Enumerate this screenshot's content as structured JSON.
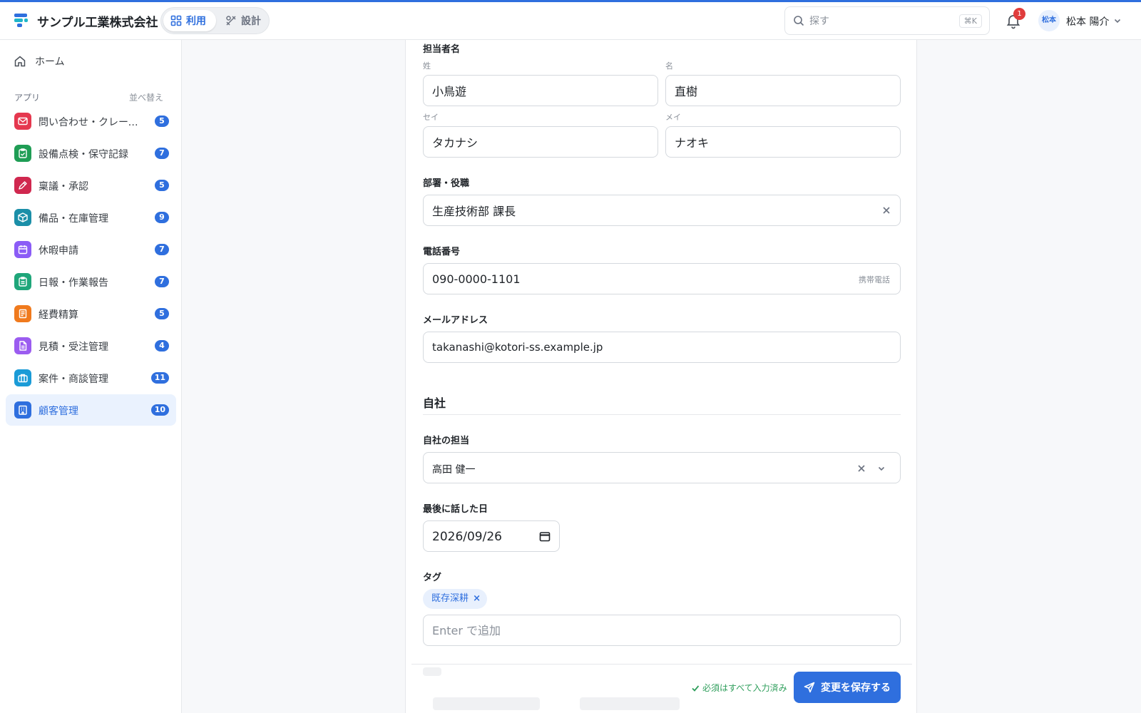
{
  "header": {
    "company": "サンプル工業株式会社",
    "mode_use": "利用",
    "mode_design": "設計",
    "search_placeholder": "探す",
    "search_shortcut": "⌘K",
    "notification_count": "1",
    "avatar_text": "松本",
    "user_name": "松本 陽介"
  },
  "sidebar": {
    "home": "ホーム",
    "apps_label": "アプリ",
    "sort_label": "並べ替え",
    "apps": [
      {
        "label": "問い合わせ・クレーム管理",
        "count": "5",
        "color": "#e5384f",
        "icon": "mail-icon"
      },
      {
        "label": "設備点検・保守記録",
        "count": "7",
        "color": "#1f9d55",
        "icon": "clipboard-check-icon"
      },
      {
        "label": "稟議・承認",
        "count": "5",
        "color": "#d0284f",
        "icon": "pen-icon"
      },
      {
        "label": "備品・在庫管理",
        "count": "9",
        "color": "#1b8fa8",
        "icon": "box-icon"
      },
      {
        "label": "休暇申請",
        "count": "7",
        "color": "#8b5cf6",
        "icon": "calendar-icon"
      },
      {
        "label": "日報・作業報告",
        "count": "7",
        "color": "#1fa67a",
        "icon": "clipboard-icon"
      },
      {
        "label": "経費精算",
        "count": "5",
        "color": "#f07a1d",
        "icon": "receipt-icon"
      },
      {
        "label": "見積・受注管理",
        "count": "4",
        "color": "#9b5cf0",
        "icon": "document-icon"
      },
      {
        "label": "案件・商談管理",
        "count": "11",
        "color": "#1a9bd7",
        "icon": "briefcase-icon"
      },
      {
        "label": "顧客管理",
        "count": "10",
        "color": "#2f6fde",
        "icon": "building-icon",
        "active": true
      }
    ]
  },
  "form": {
    "contact_label": "担当者名",
    "last_name_label": "姓",
    "last_name": "小鳥遊",
    "first_name_label": "名",
    "first_name": "直樹",
    "last_kana_label": "セイ",
    "last_kana": "タカナシ",
    "first_kana_label": "メイ",
    "first_kana": "ナオキ",
    "dept_label": "部署・役職",
    "dept_value": "生産技術部 課長",
    "phone_label": "電話番号",
    "phone_value": "090-0000-1101",
    "phone_suffix": "携帯電話",
    "email_label": "メールアドレス",
    "email_value": "takanashi@kotori-ss.example.jp",
    "section_company": "自社",
    "owner_label": "自社の担当",
    "owner_value": "高田 健一",
    "last_talk_label": "最後に話した日",
    "last_talk_value": "2026/09/26",
    "tags_label": "タグ",
    "tag_chip": "既存深耕",
    "tag_remove": "×",
    "tag_input_placeholder": "Enter で追加"
  },
  "footer": {
    "required_note": "必須はすべて入力済み",
    "save_label": "変更を保存する"
  }
}
